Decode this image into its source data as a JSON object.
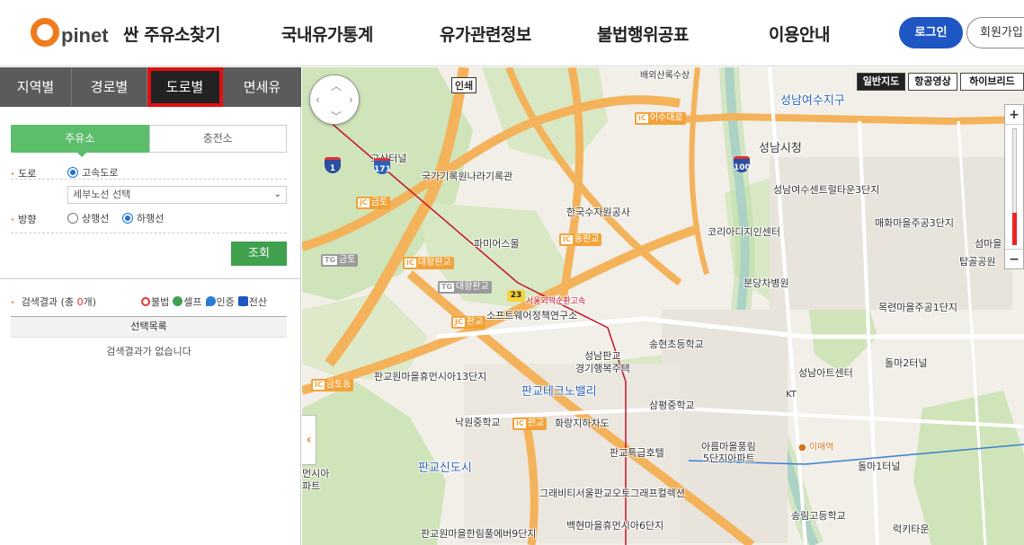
{
  "header": {
    "logo_letter": "O",
    "logo_text": "pinet",
    "logo_subtitle": "싼 주유소찾기",
    "nav": [
      "국내유가통계",
      "유가관련정보",
      "불법행위공표",
      "이용안내"
    ],
    "login_label": "로그인",
    "join_label": "회원가입"
  },
  "panel": {
    "tabs": [
      "지역별",
      "경로별",
      "도로별",
      "면세유"
    ],
    "active_tab": "도로별",
    "subtabs": [
      "주유소",
      "충전소"
    ],
    "road_label": "도로",
    "road_option": "고속도로",
    "road_select": "세부노선 선택",
    "direction_label": "방향",
    "direction_options": [
      "상행선",
      "하행선"
    ],
    "search_button": "조회",
    "result_prefix": "검색결과 (총 ",
    "result_count": "0",
    "result_suffix": "개)",
    "legend": [
      "불법",
      "셀프",
      "인증",
      "전산"
    ],
    "list_header": "선택목록",
    "empty_text": "검색결과가 없습니다"
  },
  "map": {
    "map_types": [
      "일반지도",
      "항공영상",
      "하이브리드"
    ],
    "active_type": "일반지도",
    "zoom_in": "+",
    "zoom_out": "−",
    "collapse_icon": "‹",
    "labels": {
      "inse": "인쇄",
      "top_cut": "배외산록수상",
      "seongnam_yeosu": "성남여수지구",
      "seongnam_city": "성남시청",
      "yeosu_centril": "성남여수센트럴타운3단지",
      "maehwa3": "매화마을주공3단지",
      "seommaeul": "섬마을",
      "tapgol": "탑골공원",
      "gosan_tunnel": "고산터널",
      "archives": "국가기록원나라기록관",
      "water_corp": "한국수자원공사",
      "korea_digital": "코리아디지인센터",
      "bundang_hosp": "분당차병원",
      "famidus": "파미어스몰",
      "mokryeon": "목련마을주공1단지",
      "software": "소프트웨어정책연구소",
      "songhyeon": "송현초등학교",
      "seongnam_pangyo": "성남판교",
      "gyeonggi_happy": "경기행복주택",
      "seongnam_art": "성남아트센터",
      "dolma2": "돌마2터널",
      "pangyo_center": "판교원마을휴먼시아13단지",
      "pangyo_techno": "판교테크노밸리",
      "sampyeong": "삼평중학교",
      "kt": "KT",
      "nakwon": "낙원중학교",
      "pangyo_underpass": "화랑지하차도",
      "pangyo_hotel": "판교특급호텔",
      "arum": "아름마을풍림",
      "arum2": "5단지아파트",
      "imae": "이매역",
      "dolma1": "돌마1터널",
      "pangyo_new": "판교신도시",
      "gravity": "그래비티서울판교오토그래프컬렉션",
      "songnim": "송림고등학교",
      "baekhyeon": "백현마을휴먼시아6단지",
      "pangyo_hillstate": "판교원마을한림풀에버9단지",
      "lucky": "럭키타운",
      "left_cut1": "먼시아",
      "left_cut2": "파트",
      "ring_road": "서울외곽순환고속"
    },
    "ic_labels": {
      "yeosudaero": "어수대로",
      "geumto": "금토",
      "dongpangyo": "동판교",
      "geumto_tg": "금토",
      "daewang": "대왕판교",
      "daewang_tg": "대왕판교",
      "pangyo_jc": "판교",
      "geumtodong": "금토동",
      "pangyo_ic": "판교"
    },
    "routes": [
      "1",
      "171",
      "100",
      "23"
    ]
  }
}
